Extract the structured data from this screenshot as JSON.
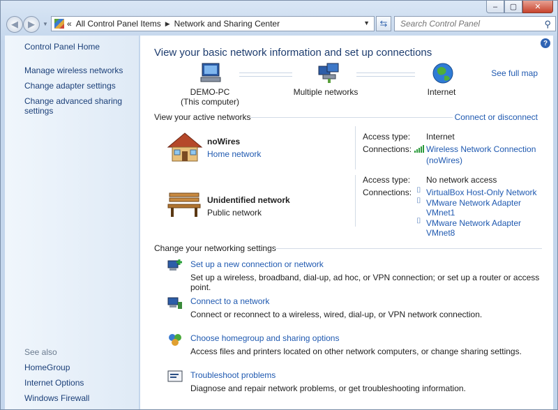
{
  "window": {
    "title_buttons": [
      "‒",
      "▢",
      "✕"
    ]
  },
  "address_bar": {
    "breadcrumbs": [
      "All Control Panel Items",
      "Network and Sharing Center"
    ],
    "overflow": "«",
    "search_placeholder": "Search Control Panel"
  },
  "sidebar": {
    "home": "Control Panel Home",
    "links": [
      "Manage wireless networks",
      "Change adapter settings",
      "Change advanced sharing settings"
    ],
    "see_also_title": "See also",
    "see_also": [
      "HomeGroup",
      "Internet Options",
      "Windows Firewall"
    ]
  },
  "main": {
    "heading": "View your basic network information and set up connections",
    "see_full_map": "See full map",
    "map": {
      "computer_name": "DEMO-PC",
      "computer_sub": "(This computer)",
      "networks": "Multiple networks",
      "internet": "Internet"
    },
    "active_networks_title": "View your active networks",
    "connect_or_disconnect": "Connect or disconnect",
    "net1": {
      "name": "noWires",
      "type": "Home network",
      "access_type_label": "Access type:",
      "access_type": "Internet",
      "connections_label": "Connections:",
      "connection_line1": "Wireless Network Connection",
      "connection_line2": "(noWires)"
    },
    "net2": {
      "name": "Unidentified network",
      "type": "Public network",
      "access_type_label": "Access type:",
      "access_type": "No network access",
      "connections_label": "Connections:",
      "connections": [
        {
          "line1": "VirtualBox Host-Only Network",
          "line2": ""
        },
        {
          "line1": "VMware Network Adapter",
          "line2": "VMnet1"
        },
        {
          "line1": "VMware Network Adapter",
          "line2": "VMnet8"
        }
      ]
    },
    "change_settings_title": "Change your networking settings",
    "tasks": [
      {
        "link": "Set up a new connection or network",
        "desc": "Set up a wireless, broadband, dial-up, ad hoc, or VPN connection; or set up a router or access point."
      },
      {
        "link": "Connect to a network",
        "desc": "Connect or reconnect to a wireless, wired, dial-up, or VPN network connection."
      },
      {
        "link": "Choose homegroup and sharing options",
        "desc": "Access files and printers located on other network computers, or change sharing settings."
      },
      {
        "link": "Troubleshoot problems",
        "desc": "Diagnose and repair network problems, or get troubleshooting information."
      }
    ],
    "help": "?"
  }
}
